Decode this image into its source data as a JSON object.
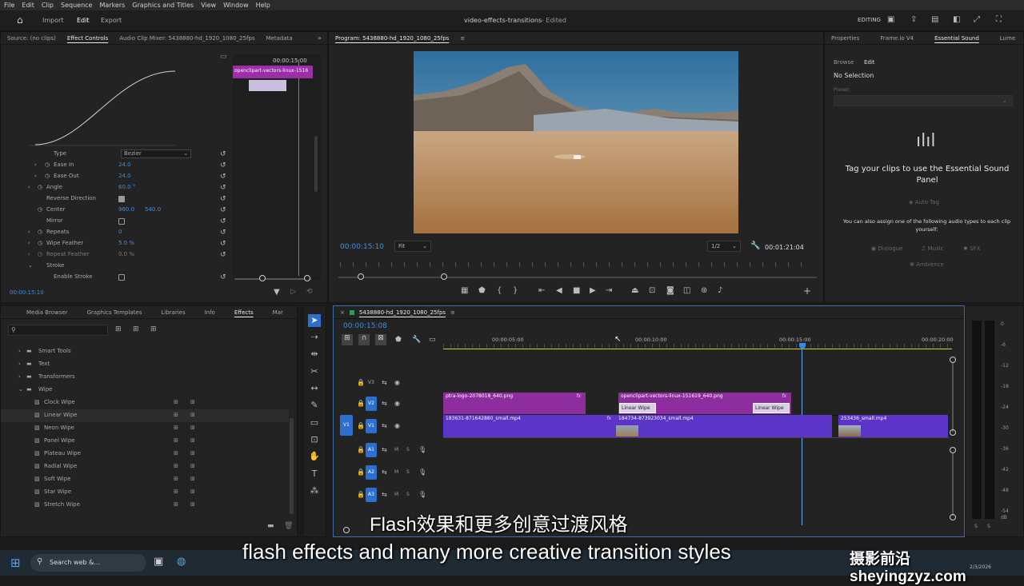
{
  "menu": [
    "File",
    "Edit",
    "Clip",
    "Sequence",
    "Markers",
    "Graphics and Titles",
    "View",
    "Window",
    "Help"
  ],
  "app": {
    "nav": [
      "Import",
      "Edit",
      "Export"
    ],
    "title": "video-effects-transitions",
    "edited": "- Edited",
    "workspace": "EDITING"
  },
  "source_panel": {
    "tabs": [
      "Source: (no clips)",
      "Effect Controls",
      "Audio Clip Mixer: 5438880-hd_1920_1080_25fps",
      "Metadata"
    ],
    "mini_timecode": "00:00:15:00",
    "mini_clip": "openclipart-vectors-linux-1516",
    "rows": {
      "type_label": "Type",
      "type_value": "Bezier",
      "ease_in": "Ease In",
      "ease_in_val": "24.0",
      "ease_out": "Ease Out",
      "ease_out_val": "24.0",
      "angle": "Angle",
      "angle_val": "60.0 °",
      "reverse": "Reverse Direction",
      "center": "Center",
      "center_x": "960.0",
      "center_y": "540.0",
      "mirror": "Mirror",
      "repeats": "Repeats",
      "repeats_val": "0",
      "wipe_feather": "Wipe Feather",
      "wipe_feather_val": "5.0 %",
      "repeat_feather": "Repeat Feather",
      "repeat_feather_val": "0.0 %",
      "stroke": "Stroke",
      "enable_stroke": "Enable Stroke"
    },
    "timecode": "00:00:15:10"
  },
  "program": {
    "tab": "Program: 5438880-hd_1920_1080_25fps",
    "timecode": "00:00:15:10",
    "fit": "Fit",
    "resolution": "1/2",
    "duration": "00:01:21:04"
  },
  "essential_sound": {
    "tabs": [
      "Properties",
      "Frame.io V4",
      "Essential Sound",
      "Lume"
    ],
    "subtabs": [
      "Browse",
      "Edit"
    ],
    "selection": "No Selection",
    "preset": "Preset:",
    "headline": "Tag your clips to use the Essential Sound Panel",
    "auto_tag": "Auto Tag",
    "hint": "You can also assign one of the following audio types to each clip yourself:",
    "types": [
      "Dialogue",
      "Music",
      "SFX",
      "Ambience"
    ]
  },
  "effects_panel": {
    "tabs": [
      "Media Browser",
      "Graphics Templates",
      "Libraries",
      "Info",
      "Effects",
      "Mar"
    ],
    "folders": [
      "Smart Tools",
      "Text",
      "Transformers",
      "Wipe"
    ],
    "items": [
      "Clock Wipe",
      "Linear Wipe",
      "Neon Wipe",
      "Panel Wipe",
      "Plateau Wipe",
      "Radial Wipe",
      "Soft Wipe",
      "Star Wipe",
      "Stretch Wipe"
    ]
  },
  "timeline": {
    "tab": "5438880-hd_1920_1080_25fps",
    "timecode": "00:00:15:08",
    "ruler": [
      "00:00:05:00",
      "00:00:10:00",
      "00:00:15:00",
      "00:00:20:00"
    ],
    "tracks": [
      "V3",
      "V2",
      "V1",
      "A1",
      "A2",
      "A3"
    ],
    "src_v1": "V1",
    "clips_v2": [
      "ptra-logo-2078018_640.png",
      "openclipart-vectors-linux-151619_640.png"
    ],
    "transitions": [
      "Linear Wipe",
      "Linear Wipe"
    ],
    "clips_v1": [
      "183631-871642880_small.mp4",
      "184734-873923034_small.mp4",
      "253436_small.mp4"
    ],
    "fx": "fx"
  },
  "meter": {
    "labels": [
      "0",
      "-6",
      "-12",
      "-18",
      "-24",
      "-30",
      "-36",
      "-42",
      "-48",
      "-54"
    ],
    "db": "dB",
    "sol": [
      "S",
      "S"
    ]
  },
  "captions": {
    "cn": "Flash效果和更多创意过渡风格",
    "en": "flash effects and many more creative transition styles",
    "watermark": "摄影前沿 sheyingzyz.com"
  },
  "taskbar": {
    "search": "Search web &...",
    "date": "2/3/2026"
  },
  "colors": {
    "accent": "#2d8ceb",
    "clip_purple": "#8e2d9e",
    "clip_violet": "#5b34c8",
    "yellow": "#d8d02a"
  }
}
